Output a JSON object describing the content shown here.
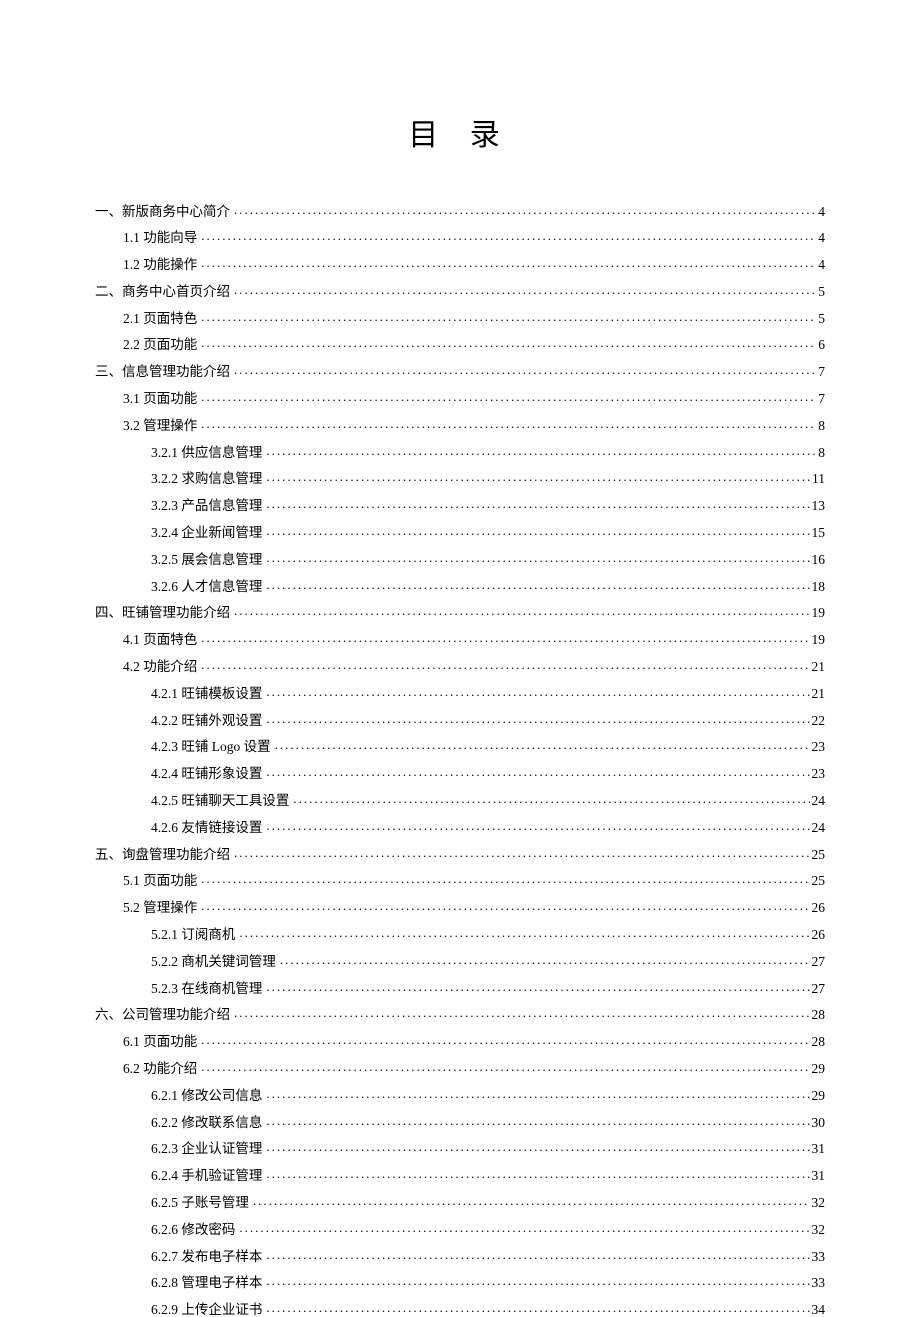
{
  "title": "目 录",
  "toc": [
    {
      "level": 1,
      "label": "一、新版商务中心简介",
      "page": "4"
    },
    {
      "level": 2,
      "label": "1.1 功能向导",
      "page": "4"
    },
    {
      "level": 2,
      "label": "1.2 功能操作",
      "page": "4"
    },
    {
      "level": 1,
      "label": "二、商务中心首页介绍",
      "page": "5"
    },
    {
      "level": 2,
      "label": "2.1 页面特色",
      "page": "5"
    },
    {
      "level": 2,
      "label": "2.2 页面功能",
      "page": "6"
    },
    {
      "level": 1,
      "label": "三、信息管理功能介绍",
      "page": "7"
    },
    {
      "level": 2,
      "label": "3.1 页面功能",
      "page": "7"
    },
    {
      "level": 2,
      "label": "3.2 管理操作",
      "page": "8"
    },
    {
      "level": 3,
      "label": "3.2.1 供应信息管理",
      "page": "8"
    },
    {
      "level": 3,
      "label": "3.2.2 求购信息管理",
      "page": "11"
    },
    {
      "level": 3,
      "label": "3.2.3 产品信息管理",
      "page": "13"
    },
    {
      "level": 3,
      "label": "3.2.4 企业新闻管理",
      "page": "15"
    },
    {
      "level": 3,
      "label": "3.2.5 展会信息管理",
      "page": "16"
    },
    {
      "level": 3,
      "label": "3.2.6 人才信息管理",
      "page": "18"
    },
    {
      "level": 1,
      "label": "四、旺铺管理功能介绍",
      "page": "19"
    },
    {
      "level": 2,
      "label": "4.1 页面特色",
      "page": "19"
    },
    {
      "level": 2,
      "label": "4.2 功能介绍",
      "page": "21"
    },
    {
      "level": 3,
      "label": "4.2.1 旺铺模板设置",
      "page": "21"
    },
    {
      "level": 3,
      "label": "4.2.2 旺铺外观设置",
      "page": "22"
    },
    {
      "level": 3,
      "label": "4.2.3 旺铺 Logo 设置",
      "page": "23"
    },
    {
      "level": 3,
      "label": "4.2.4 旺铺形象设置",
      "page": "23"
    },
    {
      "level": 3,
      "label": "4.2.5 旺铺聊天工具设置",
      "page": "24"
    },
    {
      "level": 3,
      "label": "4.2.6 友情链接设置",
      "page": "24"
    },
    {
      "level": 1,
      "label": "五、询盘管理功能介绍",
      "page": "25"
    },
    {
      "level": 2,
      "label": "5.1 页面功能",
      "page": "25"
    },
    {
      "level": 2,
      "label": "5.2 管理操作",
      "page": "26"
    },
    {
      "level": 3,
      "label": "5.2.1 订阅商机",
      "page": "26"
    },
    {
      "level": 3,
      "label": "5.2.2 商机关键词管理",
      "page": "27"
    },
    {
      "level": 3,
      "label": "5.2.3 在线商机管理",
      "page": "27"
    },
    {
      "level": 1,
      "label": "六、公司管理功能介绍",
      "page": "28"
    },
    {
      "level": 2,
      "label": "6.1 页面功能",
      "page": "28"
    },
    {
      "level": 2,
      "label": "6.2 功能介绍",
      "page": "29"
    },
    {
      "level": 3,
      "label": "6.2.1 修改公司信息",
      "page": "29"
    },
    {
      "level": 3,
      "label": "6.2.2 修改联系信息",
      "page": "30"
    },
    {
      "level": 3,
      "label": "6.2.3 企业认证管理",
      "page": "31"
    },
    {
      "level": 3,
      "label": "6.2.4 手机验证管理",
      "page": "31"
    },
    {
      "level": 3,
      "label": "6.2.5 子账号管理",
      "page": "32"
    },
    {
      "level": 3,
      "label": "6.2.6 修改密码",
      "page": "32"
    },
    {
      "level": 3,
      "label": "6.2.7 发布电子样本",
      "page": "33"
    },
    {
      "level": 3,
      "label": "6.2.8 管理电子样本",
      "page": "33"
    },
    {
      "level": 3,
      "label": "6.2.9 上传企业证书",
      "page": "34"
    }
  ]
}
